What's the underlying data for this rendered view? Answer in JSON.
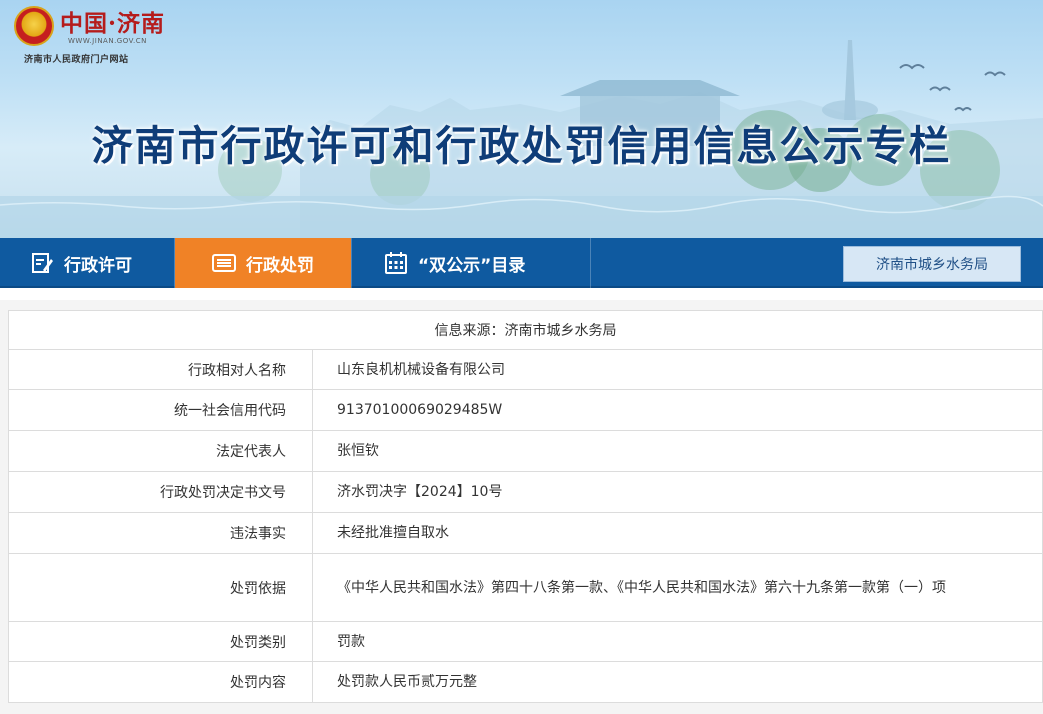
{
  "site": {
    "logo_text": "中国·济南",
    "logo_url": "WWW.JINAN.GOV.CN",
    "logo_subtitle": "济南市人民政府门户网站"
  },
  "banner": {
    "title": "济南市行政许可和行政处罚信用信息公示专栏"
  },
  "nav": {
    "items": [
      {
        "label": "行政许可",
        "icon": "edit-document-icon",
        "active": false
      },
      {
        "label": "行政处罚",
        "icon": "list-card-icon",
        "active": true
      },
      {
        "label": "“双公示”目录",
        "icon": "calendar-icon",
        "active": false
      }
    ],
    "department_button": "济南市城乡水务局"
  },
  "record": {
    "source_text": "信息来源：济南市城乡水务局",
    "rows": [
      {
        "label": "行政相对人名称",
        "value": "山东良机机械设备有限公司"
      },
      {
        "label": "统一社会信用代码",
        "value": "91370100069029485W"
      },
      {
        "label": "法定代表人",
        "value": "张恒钦"
      },
      {
        "label": "行政处罚决定书文号",
        "value": "济水罚决字【2024】10号"
      },
      {
        "label": "违法事实",
        "value": "未经批准擅自取水"
      },
      {
        "label": "处罚依据",
        "value": "《中华人民共和国水法》第四十八条第一款、《中华人民共和国水法》第六十九条第一款第（一）项"
      },
      {
        "label": "处罚类别",
        "value": "罚款"
      },
      {
        "label": "处罚内容",
        "value": "处罚款人民币贰万元整"
      }
    ]
  },
  "colors": {
    "nav_bg": "#0f5aa0",
    "nav_active": "#f08226",
    "title": "#0f3d78",
    "logo_red": "#b51c1c"
  }
}
